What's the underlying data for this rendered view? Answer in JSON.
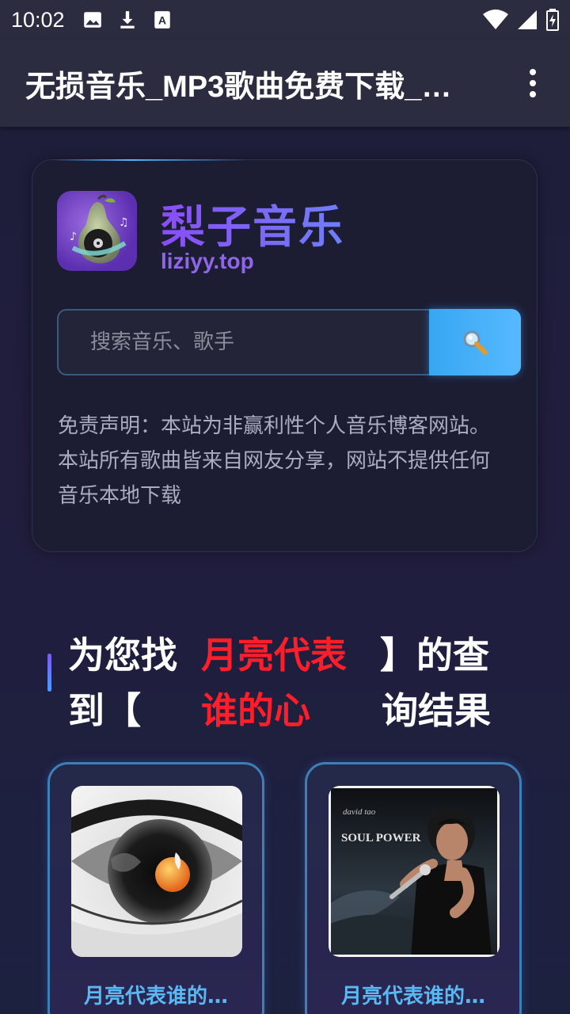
{
  "status_bar": {
    "time": "10:02",
    "icons_left": [
      "image-icon",
      "download-icon",
      "font-icon"
    ],
    "icons_right": [
      "wifi-icon",
      "signal-icon",
      "battery-icon"
    ]
  },
  "app_bar": {
    "title": "无损音乐_MP3歌曲免费下载_…"
  },
  "brand": {
    "name": "梨子音乐",
    "domain": "liziyy.top"
  },
  "search": {
    "placeholder": "搜索音乐、歌手"
  },
  "disclaimer": "免责声明：本站为非赢利性个人音乐博客网站。本站所有歌曲皆来自网友分享，网站不提供任何音乐本地下载",
  "result_heading": {
    "line1_prefix": "为您找",
    "keyword_part1": "月亮代表",
    "line1_suffix": "】的查",
    "line2_prefix": "到【",
    "keyword_part2": "谁的心",
    "line2_suffix": "询结果"
  },
  "results": [
    {
      "title": "月亮代表谁的…"
    },
    {
      "title": "月亮代表谁的…"
    }
  ],
  "album_cover_text": {
    "artist": "david tao",
    "album": "SOUL POWER"
  },
  "colors": {
    "accent_blue": "#4fb3ff",
    "keyword_red": "#ff1e2a",
    "brand_purple": "#8a4df6"
  }
}
